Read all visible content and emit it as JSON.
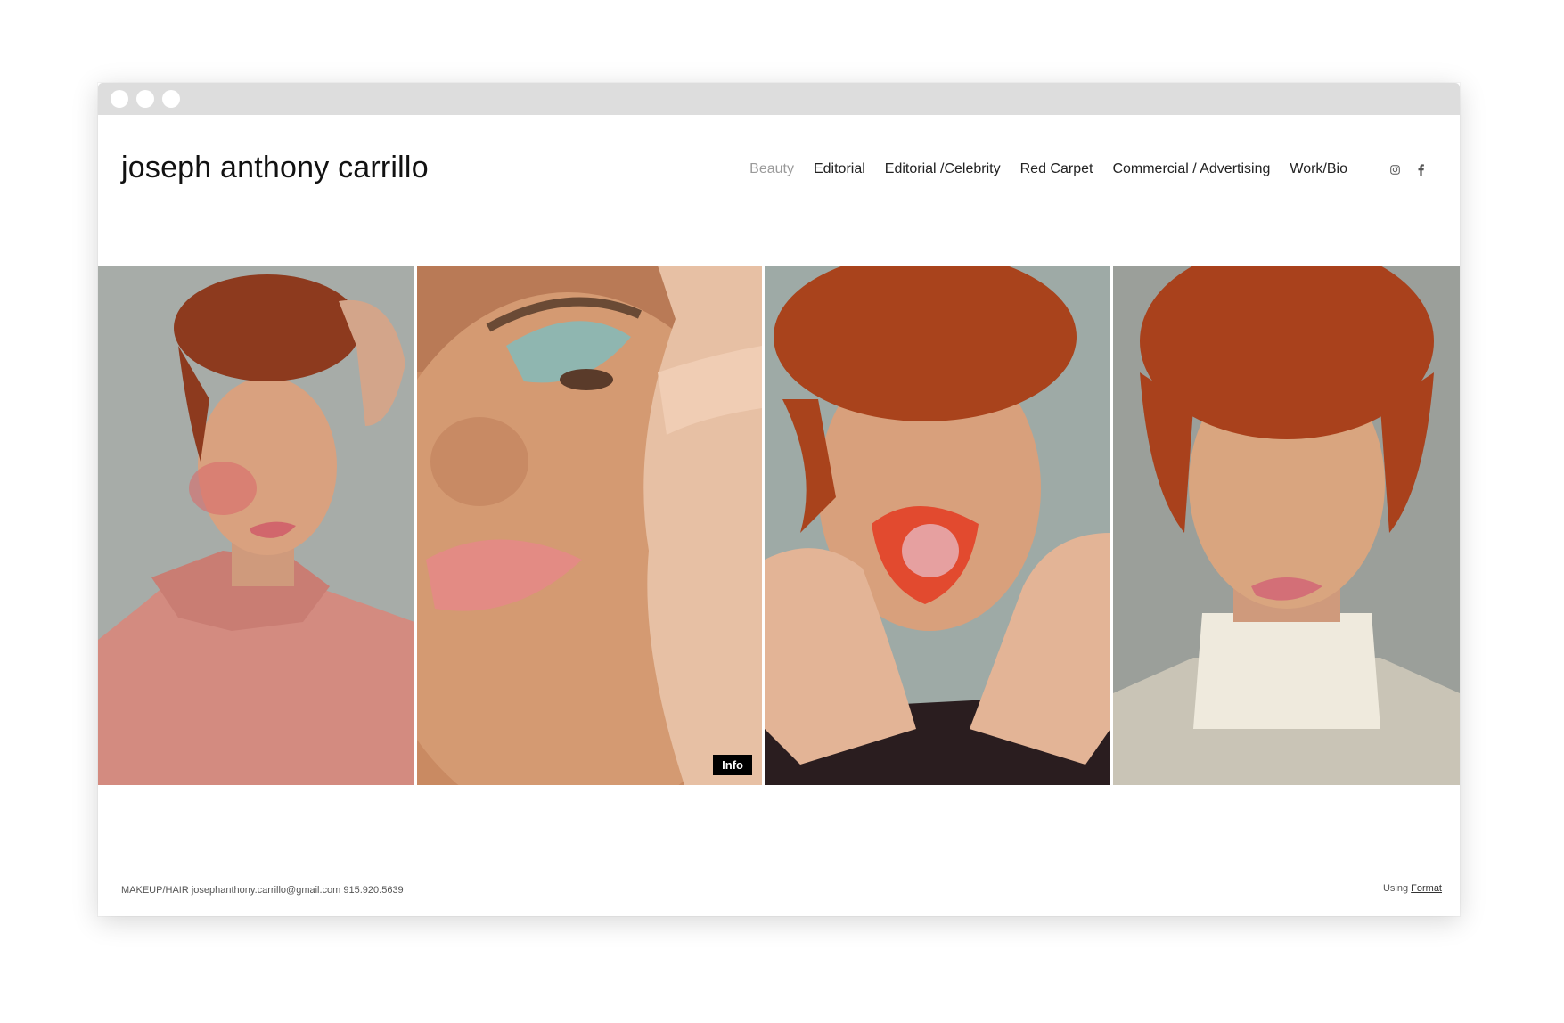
{
  "site": {
    "title": "joseph anthony carrillo"
  },
  "nav": {
    "items": [
      {
        "label": "Beauty",
        "active": true
      },
      {
        "label": "Editorial"
      },
      {
        "label": "Editorial /Celebrity"
      },
      {
        "label": "Red Carpet"
      },
      {
        "label": "Commercial / Advertising"
      },
      {
        "label": "Work/Bio"
      }
    ],
    "social": [
      "instagram-icon",
      "facebook-icon"
    ]
  },
  "gallery": {
    "info_label": "Info"
  },
  "footer": {
    "contact": "MAKEUP/HAIR josephanthony.carrillo@gmail.com 915.920.5639",
    "using_label": "Using",
    "platform_link": "Format"
  },
  "colors": {
    "active_nav": "#9a9a9a",
    "text": "#222222",
    "chrome": "#dddddd"
  }
}
